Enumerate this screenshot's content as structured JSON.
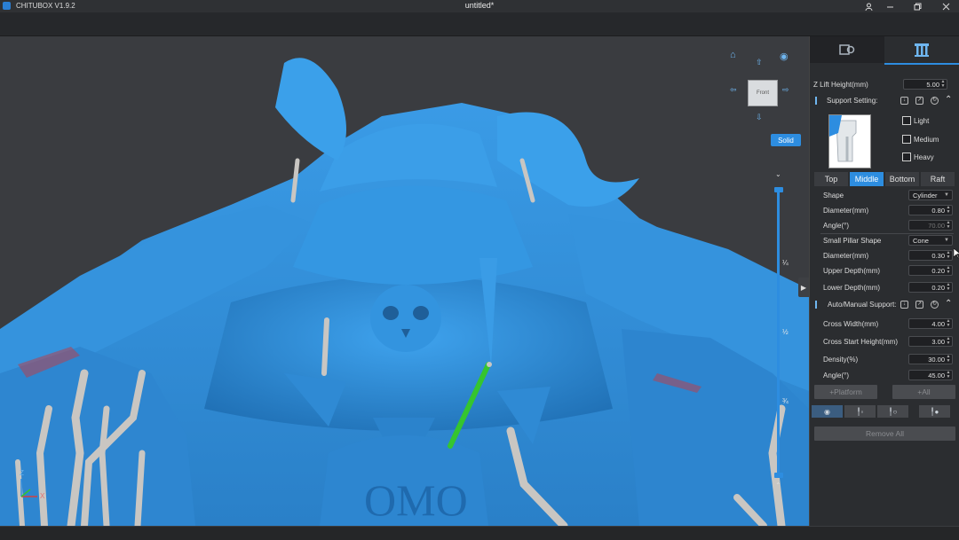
{
  "titlebar": {
    "app_name": "CHITUBOX V1.9.2",
    "document": "untitled*"
  },
  "viewport": {
    "view_label": "Front",
    "render_mode": "Solid",
    "slider_ticks": [
      "¼",
      "½",
      "¾"
    ],
    "axis": {
      "z": "Z",
      "x": "X"
    },
    "model_color": "#2f8ed8",
    "support_color": "#c9c6c2",
    "selected_support_color": "#35c52f"
  },
  "panel": {
    "tabs": [
      {
        "name": "settings-tab"
      },
      {
        "name": "support-tab"
      }
    ],
    "z_lift": {
      "label": "Z Lift Height(mm)",
      "value": "5.00"
    },
    "support_setting": {
      "label": "Support Setting:"
    },
    "density_options": [
      {
        "label": "Light",
        "checked": false
      },
      {
        "label": "Medium",
        "checked": false
      },
      {
        "label": "Heavy",
        "checked": false
      }
    ],
    "segments": [
      {
        "label": "Top"
      },
      {
        "label": "Middle",
        "active": true
      },
      {
        "label": "Bottom"
      },
      {
        "label": "Raft"
      }
    ],
    "middle": {
      "shape": {
        "label": "Shape",
        "value": "Cylinder"
      },
      "diameter": {
        "label": "Diameter(mm)",
        "value": "0.80"
      },
      "angle": {
        "label": "Angle(°)",
        "value": "70.00"
      },
      "small_pillar_shape": {
        "label": "Small Pillar Shape",
        "value": "Cone"
      },
      "small_diameter": {
        "label": "Diameter(mm)",
        "value": "0.30"
      },
      "upper_depth": {
        "label": "Upper Depth(mm)",
        "value": "0.20"
      },
      "lower_depth": {
        "label": "Lower Depth(mm)",
        "value": "0.20"
      }
    },
    "auto_manual": {
      "label": "Auto/Manual Support:"
    },
    "auto": {
      "cross_width": {
        "label": "Cross Width(mm)",
        "value": "4.00"
      },
      "cross_start": {
        "label": "Cross Start Height(mm)",
        "value": "3.00"
      },
      "density": {
        "label": "Density(%)",
        "value": "30.00"
      },
      "angle": {
        "label": "Angle(°)",
        "value": "45.00"
      }
    },
    "buttons": {
      "platform": "+Platform",
      "all": "+All",
      "remove_all": "Remove All"
    }
  }
}
